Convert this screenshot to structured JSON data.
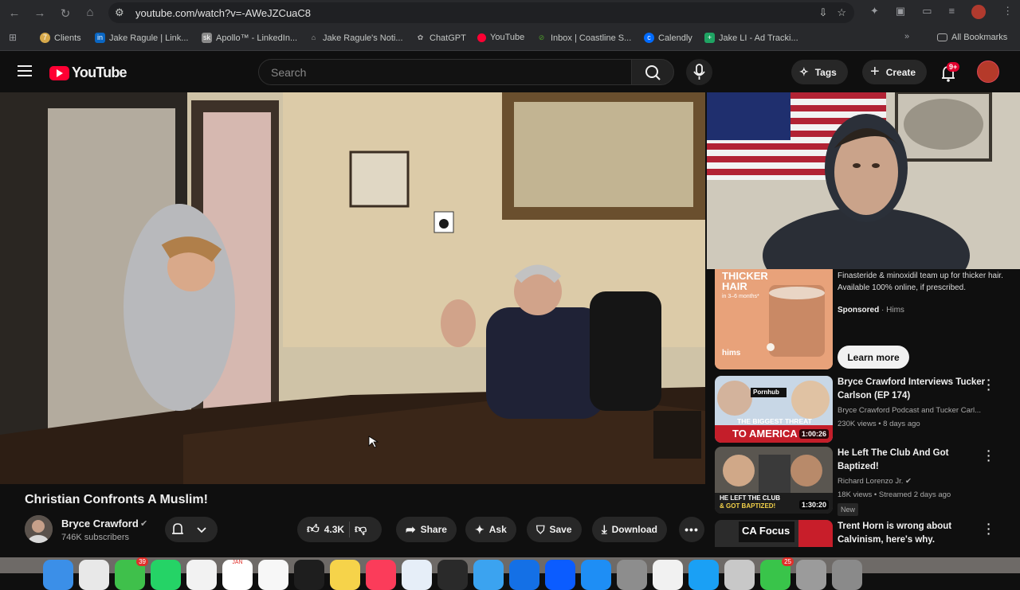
{
  "browser": {
    "url": "youtube.com/watch?v=-AWeJZCuaC8",
    "bookmarks": [
      {
        "label": "Clients",
        "icon": "clients-icon",
        "color": "#d7a94b"
      },
      {
        "label": "Jake Ragule | Link...",
        "icon": "linkedin-icon",
        "color": "#0a66c2"
      },
      {
        "label": "Apollo™ - LinkedIn...",
        "icon": "apollo-icon",
        "color": "#8a8a8a"
      },
      {
        "label": "Jake Ragule's Noti...",
        "icon": "notion-icon",
        "color": "#777"
      },
      {
        "label": "ChatGPT",
        "icon": "chatgpt-icon",
        "color": "#666"
      },
      {
        "label": "YouTube",
        "icon": "youtube-icon",
        "color": "#ff0033"
      },
      {
        "label": "Inbox | Coastline S...",
        "icon": "inbox-icon",
        "color": "#4c9a2a"
      },
      {
        "label": "Calendly",
        "icon": "calendly-icon",
        "color": "#006bff"
      },
      {
        "label": "Jake LI - Ad Tracki...",
        "icon": "sheets-icon",
        "color": "#1fa463"
      }
    ],
    "all_bookmarks": "All Bookmarks"
  },
  "youtube": {
    "logo": "YouTube",
    "search_placeholder": "Search",
    "tags_label": "Tags",
    "create_label": "Create",
    "notification_count": "9+",
    "accent": "#ff0033"
  },
  "video": {
    "title": "Christian Confronts A Muslim!",
    "channel": "Bryce Crawford",
    "subscribers": "746K subscribers",
    "likes": "4.3K",
    "share": "Share",
    "ask": "Ask",
    "save": "Save",
    "download": "Download"
  },
  "ad": {
    "thumb_title": "THICKER HAIR",
    "thumb_sub": "in 3–6 months*",
    "thumb_brand": "hims",
    "text": "Finasteride & minoxidil team up for thicker hair. Available 100% online, if prescribed.",
    "sponsored": "Sponsored",
    "advertiser": "Hims",
    "cta": "Learn more"
  },
  "recommendations": [
    {
      "title": "Bryce Crawford Interviews Tucker Carlson (EP 174)",
      "channel": "Bryce Crawford Podcast and Tucker Carl...",
      "stats": "230K views • 8 days ago",
      "duration": "1:00:26",
      "thumb_text_1": "THE BIGGEST THREAT",
      "thumb_text_2": "TO AMERICA",
      "thumb_text_3": "Pornhub"
    },
    {
      "title": "He Left The Club And Got Baptized!",
      "channel": "Richard Lorenzo Jr.",
      "stats": "18K views • Streamed 2 days ago",
      "duration": "1:30:20",
      "badge": "New",
      "thumb_text_1": "HE LEFT THE CLUB",
      "thumb_text_2": "& GOT BAPTIZED!"
    },
    {
      "title": "Trent Horn is wrong about Calvinism, here's why.",
      "thumb_text_1": "CA Focus"
    }
  ],
  "dock": {
    "messages_badge": "39",
    "mail_badge": "25",
    "calendar_month": "JAN"
  }
}
